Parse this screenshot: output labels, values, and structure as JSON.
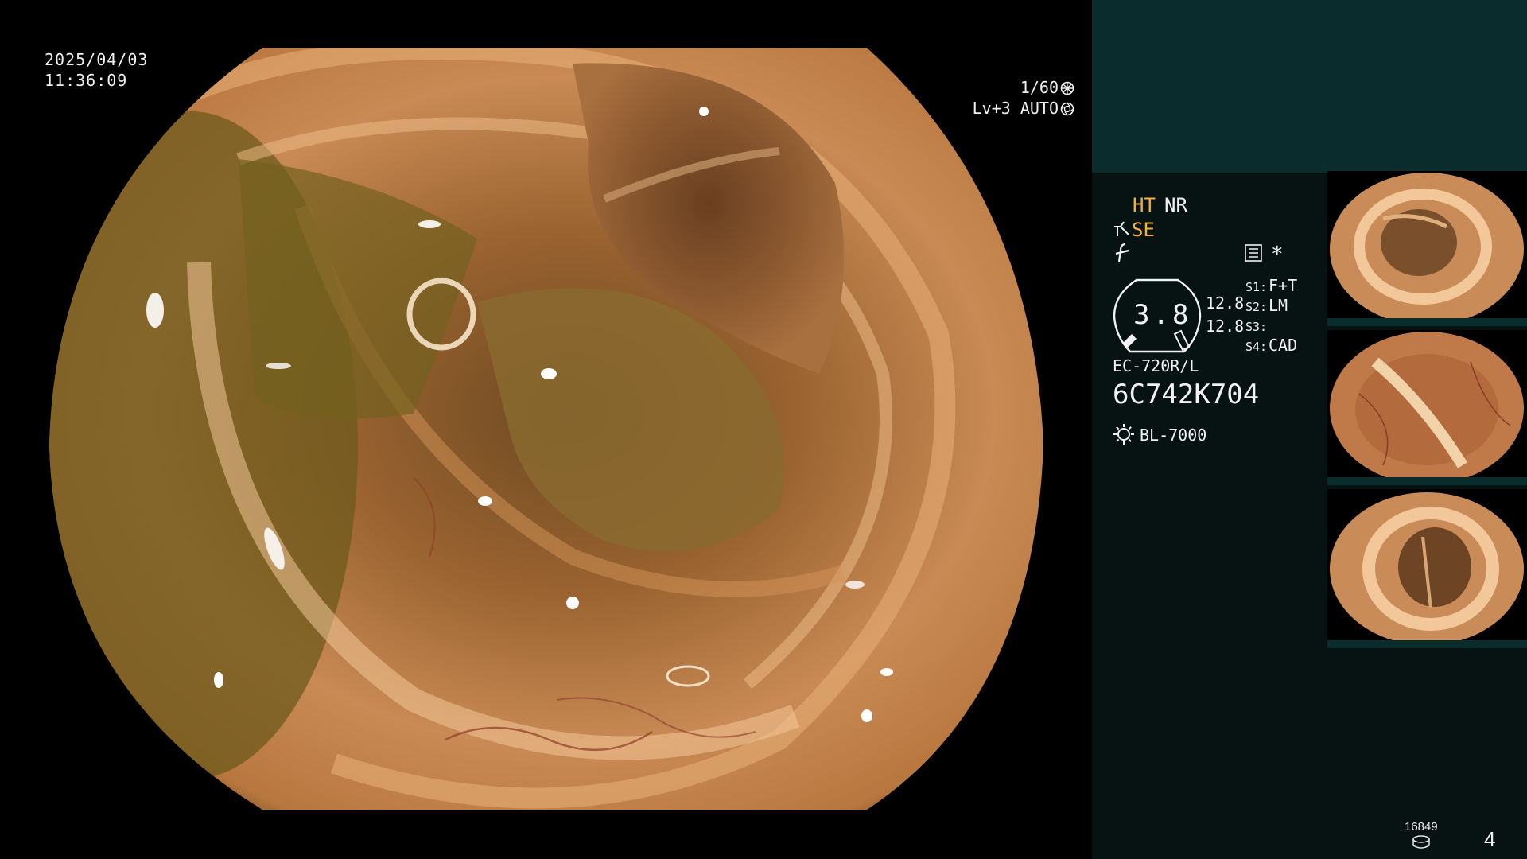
{
  "overlay": {
    "date": "2025/04/03",
    "time": "11:36:09",
    "shutter": "1/60",
    "level": "Lv+3",
    "iris": "AUTO"
  },
  "panel": {
    "ht": "HT",
    "nr": "NR",
    "se": "SE",
    "star": "*",
    "gauge_value": "3.8",
    "value_a": "12.8",
    "value_b": "12.8",
    "slots": [
      {
        "key": "S1:",
        "value": "F+T"
      },
      {
        "key": "S2:",
        "value": "LM"
      },
      {
        "key": "S3:",
        "value": ""
      },
      {
        "key": "S4:",
        "value": "CAD"
      }
    ],
    "scope_model": "EC-720R/L",
    "scope_serial": "6C742K704",
    "light_source": "BL-7000",
    "counter": "16849",
    "page": "4"
  },
  "colors": {
    "panel_bg": "#071212",
    "panel_header": "#0b2c2c",
    "accent_orange": "#f1b233",
    "text": "#f2f2f2"
  },
  "icons": [
    "shutter-icon",
    "iris-icon",
    "se-enhance-icon",
    "f-symbol-icon",
    "menu-list-icon",
    "gauge-icon",
    "light-source-icon",
    "database-icon"
  ]
}
